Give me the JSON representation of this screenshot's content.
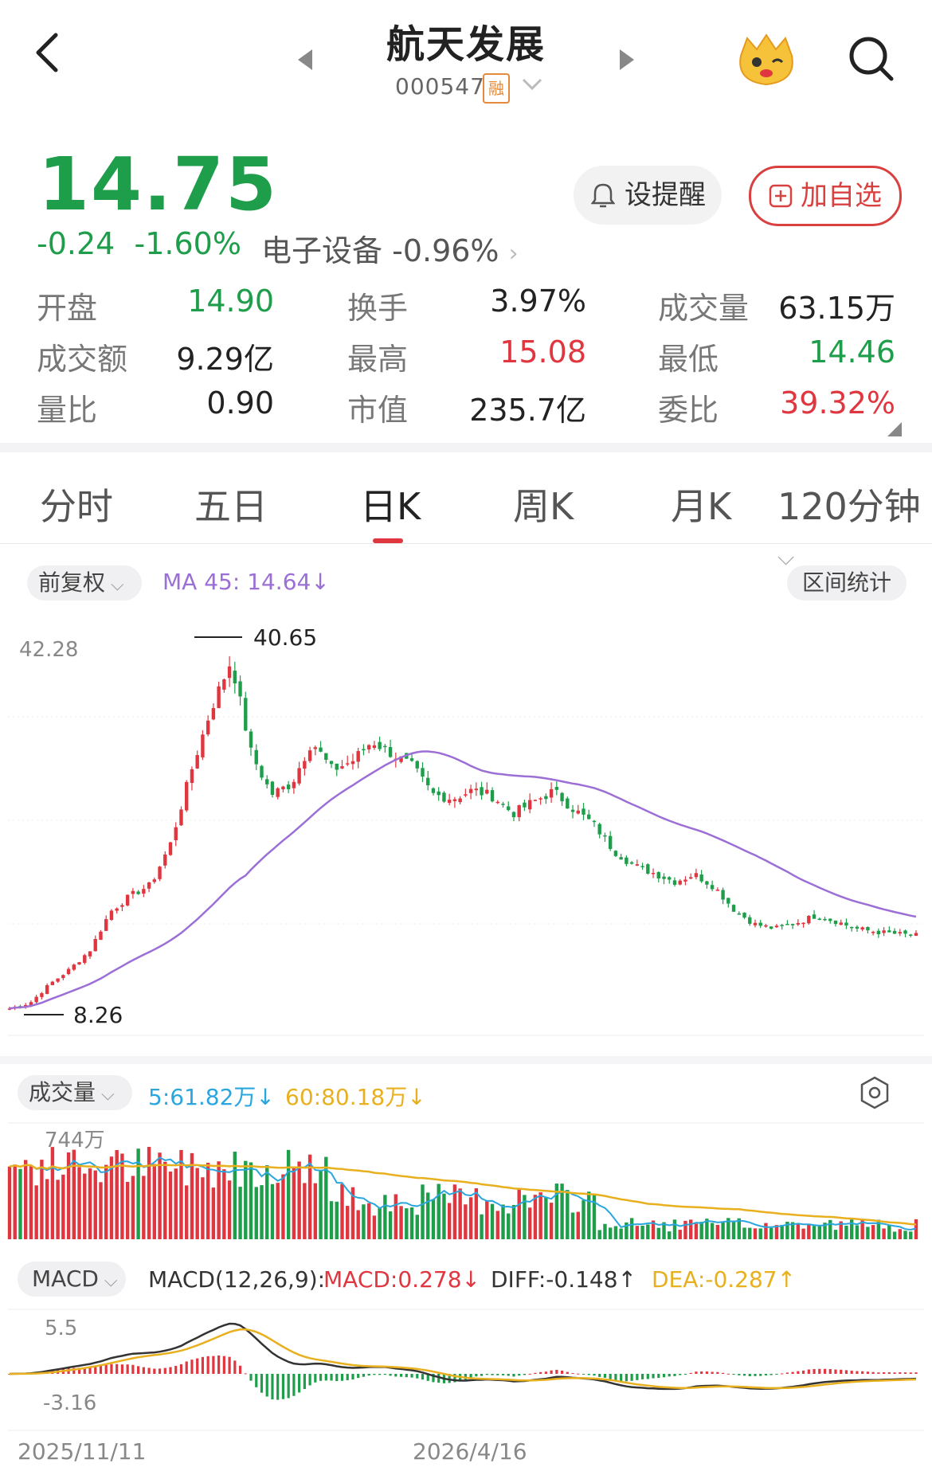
{
  "header": {
    "stock_name": "航天发展",
    "stock_code": "000547",
    "margin_badge": "融"
  },
  "quote": {
    "price": "14.75",
    "change": "-0.24",
    "change_pct": "-1.60%",
    "sector": "电子设备",
    "sector_pct": "-0.96%",
    "remind_label": "设提醒",
    "add_label": "加自选",
    "price_color": "#1e9e4a"
  },
  "stats": {
    "open_label": "开盘",
    "open": "14.90",
    "turnover_label": "换手",
    "turnover": "3.97%",
    "volume_label": "成交量",
    "volume": "63.15万",
    "amount_label": "成交额",
    "amount": "9.29亿",
    "high_label": "最高",
    "high": "15.08",
    "low_label": "最低",
    "low": "14.46",
    "vol_ratio_label": "量比",
    "vol_ratio": "0.90",
    "mktcap_label": "市值",
    "mktcap": "235.7亿",
    "order_ratio_label": "委比",
    "order_ratio": "39.32%"
  },
  "tabs": [
    "分时",
    "五日",
    "日K",
    "周K",
    "月K",
    "120分钟"
  ],
  "active_tab": "日K",
  "kline": {
    "adjust_label": "前复权",
    "ma_label": "MA 45: 14.64",
    "range_stats_label": "区间统计",
    "axis_top": "42.28",
    "max_label": "40.65",
    "min_label": "8.26"
  },
  "volume_panel": {
    "title": "成交量",
    "ma5": "5:61.82万",
    "ma60": "60:80.18万",
    "axis_top": "744万"
  },
  "macd_panel": {
    "title": "MACD",
    "params": "MACD(12,26,9):",
    "macd": "MACD:0.278",
    "diff": "DIFF:-0.148",
    "dea": "DEA:-0.287",
    "axis_top": "5.5",
    "axis_bottom": "-3.16"
  },
  "dates": {
    "start": "2025/11/11",
    "mid": "2026/4/16"
  },
  "colors": {
    "up": "#e0363f",
    "down": "#1e9e4a",
    "ma45": "#9b6fd6",
    "vol_ma5": "#2aa6df",
    "vol_ma60": "#e8b01e",
    "dea": "#e8b01e",
    "diff": "#333333"
  },
  "chart_data": {
    "type": "candlestick",
    "approx_close_path": [
      7.9,
      8.4,
      10.2,
      11.6,
      13.4,
      17.0,
      18.5,
      19.5,
      23.4,
      30.1,
      36.0,
      40.6,
      31.8,
      28.0,
      29.0,
      33.0,
      30.3,
      31.1,
      33.0,
      31.8,
      30.6,
      28.0,
      27.6,
      28.4,
      27.8,
      26.2,
      27.3,
      28.3,
      26.6,
      25.2,
      22.7,
      21.3,
      20.6,
      19.8,
      20.5,
      19.3,
      17.1,
      15.8,
      15.4,
      15.9,
      16.6,
      16.1,
      15.4,
      15.1,
      14.9,
      14.75
    ],
    "ma45_last": 14.64,
    "ylim": [
      8.26,
      42.28
    ]
  }
}
